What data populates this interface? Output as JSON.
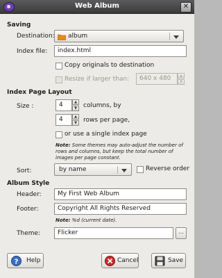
{
  "window": {
    "title": "Web Album"
  },
  "saving": {
    "heading": "Saving",
    "destination_label": "Destination:",
    "destination_value": "album",
    "index_file_label": "Index file:",
    "index_file_value": "index.html",
    "copy_originals_label": "Copy originals to destination",
    "resize_label": "Resize if larger than:",
    "resize_value": "640 x 480"
  },
  "layout": {
    "heading": "Index Page Layout",
    "size_label": "Size :",
    "columns_value": "4",
    "columns_suffix": "columns, by",
    "rows_value": "4",
    "rows_suffix": "rows per page,",
    "single_page_label": "or use a single index page",
    "note_bold": "Note:",
    "note_text": " Some themes may auto-adjust the number of rows and columns, but keep the total number of images per page constant.",
    "sort_label": "Sort:",
    "sort_value": "by name",
    "reverse_label": "Reverse order"
  },
  "style": {
    "heading": "Album Style",
    "header_label": "Header:",
    "header_value": "My First Web Album",
    "footer_label": "Footer:",
    "footer_value": "Copyright All Rights Reserved",
    "footer_note_bold": "Note:",
    "footer_note_text": " %d (current date).",
    "theme_label": "Theme:",
    "theme_value": "Flicker",
    "browse_label": "..."
  },
  "buttons": {
    "help": "Help",
    "cancel": "Cancel",
    "save": "Save"
  },
  "colors": {
    "titlebar": "#4a4a4a",
    "dialog_bg": "#edebe7",
    "folder": "#e8891a",
    "cancel_red": "#cc2a2a"
  }
}
